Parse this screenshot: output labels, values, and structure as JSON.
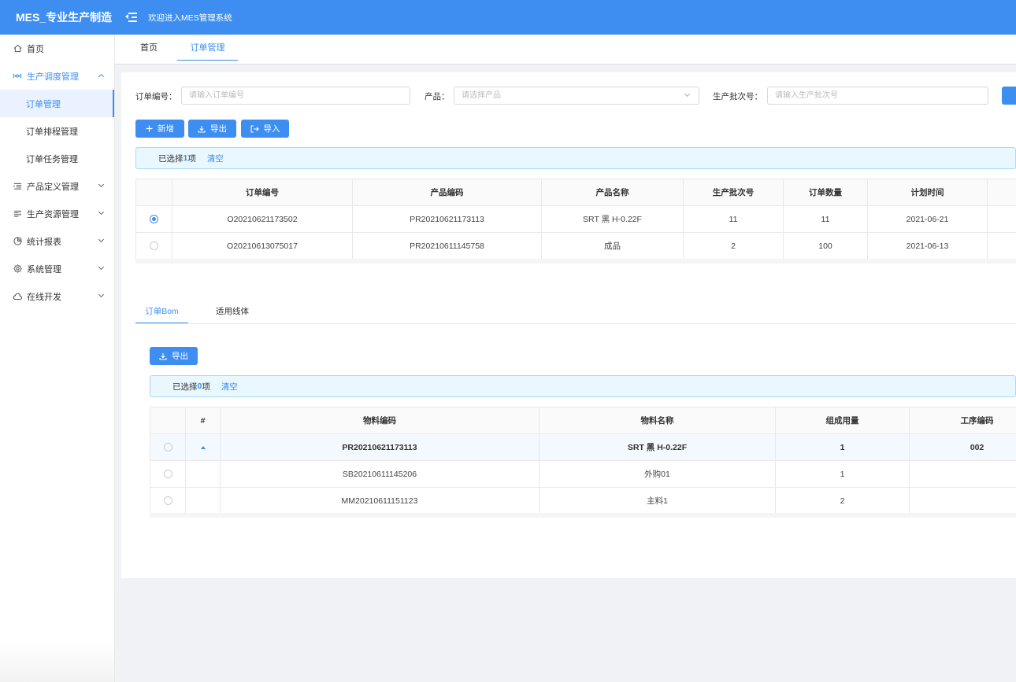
{
  "header": {
    "logo": "MES_专业生产制造",
    "welcome": "欢迎进入MES管理系统"
  },
  "sidebar": {
    "items": [
      {
        "label": "首页",
        "icon": "home-icon"
      },
      {
        "label": "生产调度管理",
        "icon": "schedule-icon",
        "open": true,
        "children": [
          {
            "label": "订单管理",
            "active": true
          },
          {
            "label": "订单排程管理"
          },
          {
            "label": "订单任务管理"
          }
        ]
      },
      {
        "label": "产品定义管理",
        "icon": "list-icon"
      },
      {
        "label": "生产资源管理",
        "icon": "resource-icon"
      },
      {
        "label": "统计报表",
        "icon": "pie-chart-icon"
      },
      {
        "label": "系统管理",
        "icon": "gear-icon"
      },
      {
        "label": "在线开发",
        "icon": "cloud-icon"
      }
    ]
  },
  "page_tabs": [
    {
      "label": "首页"
    },
    {
      "label": "订单管理",
      "active": true
    }
  ],
  "filters": {
    "order_no": {
      "label": "订单编号：",
      "placeholder": "请输入订单编号"
    },
    "product": {
      "label": "产品：",
      "placeholder": "请选择产品"
    },
    "batch_no": {
      "label": "生产批次号：",
      "placeholder": "请输入生产批次号"
    }
  },
  "toolbar": {
    "add": "新增",
    "export": "导出",
    "import": "导入"
  },
  "selection_top": {
    "prefix": "已选择 ",
    "count": "1",
    "suffix": "项",
    "clear": "清空"
  },
  "order_table": {
    "columns": [
      "订单编号",
      "产品编码",
      "产品名称",
      "生产批次号",
      "订单数量",
      "计划时间"
    ],
    "rows": [
      {
        "selected": true,
        "cells": [
          "O20210621173502",
          "PR20210621173113",
          "SRT 黑 H-0.22F",
          "11",
          "11",
          "2021-06-21"
        ]
      },
      {
        "selected": false,
        "cells": [
          "O20210613075017",
          "PR20210611145758",
          "成品",
          "2",
          "100",
          "2021-06-13"
        ]
      }
    ]
  },
  "bottom_tabs": [
    {
      "label": "订单Bom",
      "active": true
    },
    {
      "label": "适用线体"
    }
  ],
  "bom_toolbar": {
    "export": "导出"
  },
  "selection_bom": {
    "prefix": "已选择 ",
    "count": "0",
    "suffix": "项",
    "clear": "清空"
  },
  "bom_table": {
    "columns": [
      "#",
      "物料编码",
      "物料名称",
      "组成用量",
      "工序编码"
    ],
    "rows": [
      {
        "expanded": true,
        "highlight": true,
        "cells": [
          "PR20210621173113",
          "SRT 黑 H-0.22F",
          "1",
          "002"
        ]
      },
      {
        "cells": [
          "SB20210611145206",
          "外购01",
          "1",
          ""
        ]
      },
      {
        "cells": [
          "MM20210611151123",
          "主料1",
          "2",
          ""
        ]
      }
    ]
  }
}
